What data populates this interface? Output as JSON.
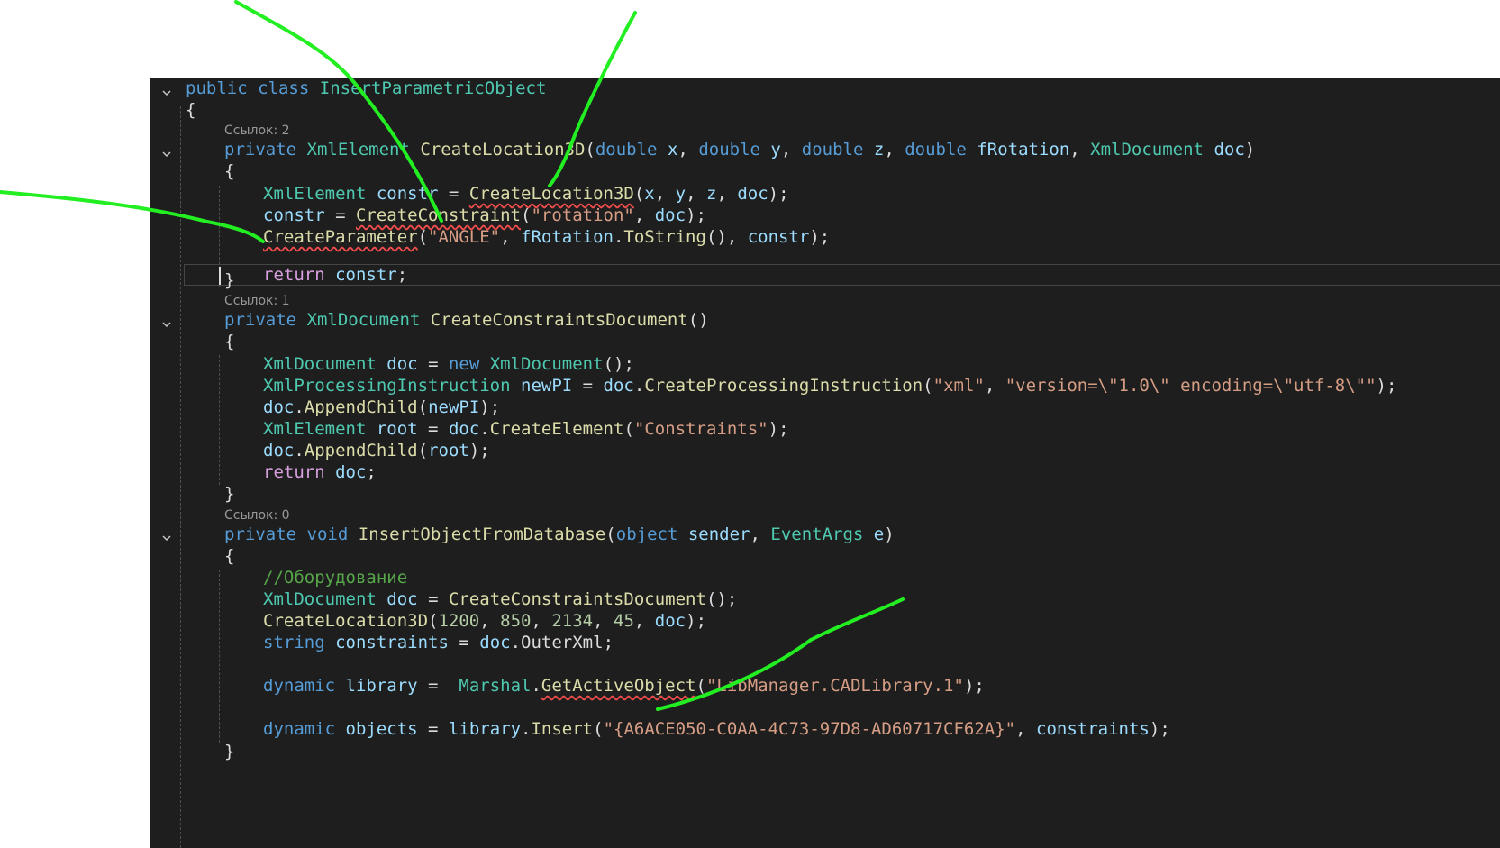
{
  "code": {
    "class_decl": {
      "kw1": "public",
      "kw2": "class",
      "name": "InsertParametricObject"
    },
    "open_brace": "{",
    "close_brace": "}",
    "semicolon": ";",
    "comma": ",",
    "ref_counts": [
      "Ссылок: 2",
      "Ссылок: 1",
      "Ссылок: 0"
    ],
    "m1": {
      "kw": "private",
      "ret": "XmlElement",
      "name": "CreateLocation3D",
      "p_type": "double",
      "p1": "x",
      "p2": "y",
      "p3": "z",
      "p4": "fRotation",
      "p5_type": "XmlDocument",
      "p5": "doc",
      "l1_type": "XmlElement",
      "l1_var": "constr",
      "l1_call": "CreateLocation3D",
      "l2_var": "constr",
      "l2_call": "CreateConstraint",
      "l2_str": "\"rotation\"",
      "l2_arg": "doc",
      "l3_call": "CreateParameter",
      "l3_str": "\"ANGLE\"",
      "l3_obj": "fRotation",
      "l3_method": "ToString",
      "l3_arg": "constr",
      "l4_kw": "return",
      "l4_var": "constr"
    },
    "m2": {
      "kw": "private",
      "ret": "XmlDocument",
      "name": "CreateConstraintsDocument",
      "l1_type": "XmlDocument",
      "l1_var": "doc",
      "l1_new": "new",
      "l1_ctor": "XmlDocument",
      "l2_type": "XmlProcessingInstruction",
      "l2_var": "newPI",
      "l2_obj": "doc",
      "l2_call": "CreateProcessingInstruction",
      "l2_str1": "\"xml\"",
      "l2_str2": "\"version=\\\"1.0\\\" encoding=\\\"utf-8\\\"\"",
      "l3_obj": "doc",
      "l3_call": "AppendChild",
      "l3_arg": "newPI",
      "l4_type": "XmlElement",
      "l4_var": "root",
      "l4_obj": "doc",
      "l4_call": "CreateElement",
      "l4_str": "\"Constraints\"",
      "l5_obj": "doc",
      "l5_call": "AppendChild",
      "l5_arg": "root",
      "l6_kw": "return",
      "l6_var": "doc"
    },
    "m3": {
      "kw1": "private",
      "kw2": "void",
      "name": "InsertObjectFromDatabase",
      "p1_type": "object",
      "p1": "sender",
      "p2_type": "EventArgs",
      "p2": "e",
      "comment": "//Оборудование",
      "l1_type": "XmlDocument",
      "l1_var": "doc",
      "l1_call": "CreateConstraintsDocument",
      "l2_call": "CreateLocation3D",
      "l2_n1": "1200",
      "l2_n2": "850",
      "l2_n3": "2134",
      "l2_n4": "45",
      "l2_arg": "doc",
      "l3_type": "string",
      "l3_var": "constraints",
      "l3_obj": "doc",
      "l3_prop": "OuterXml",
      "l4_kw": "dynamic",
      "l4_var": "library",
      "l4_cls": "Marshal",
      "l4_call": "GetActiveObject",
      "l4_str": "\"LibManager.CADLibrary.1\"",
      "l5_kw": "dynamic",
      "l5_var": "objects",
      "l5_obj": "library",
      "l5_call": "Insert",
      "l5_str": "\"{A6ACE050-C0AA-4C73-97D8-AD60717CF62A}\"",
      "l5_arg": "constraints"
    }
  },
  "colors": {
    "editor_bg": "#1e1e1e",
    "keyword": "#569cd6",
    "control_keyword": "#d8a0df",
    "type": "#4ec9b0",
    "method": "#dcdcaa",
    "variable": "#9cdcfe",
    "string": "#d69d85",
    "number": "#b5cea8",
    "comment": "#57a64a",
    "annotation": "#22ee22"
  }
}
